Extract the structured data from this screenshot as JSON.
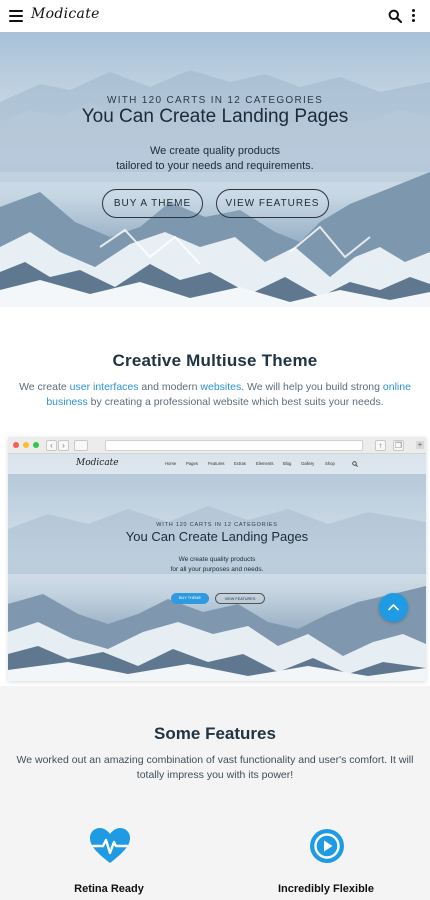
{
  "topbar": {
    "logo": "Modicate",
    "menu_icon": "hamburger-menu-icon",
    "search_icon": "search-icon",
    "more_icon": "more-vertical-icon"
  },
  "hero": {
    "eyebrow": "WITH 120 CARTS IN 12 CATEGORIES",
    "title": "You Can Create Landing Pages",
    "subtitle_line1": "We create quality products",
    "subtitle_line2": "tailored to your needs and requirements.",
    "buy_label": "BUY A THEME",
    "view_label": "VIEW FEATURES"
  },
  "intro": {
    "title": "Creative Multiuse Theme",
    "text_1": "We create ",
    "link_1": "user interfaces",
    "text_2": " and modern ",
    "link_2": "websites",
    "text_3": ". We will help you build strong ",
    "link_3": "online business",
    "text_4": " by creating a professional website which best suits your needs."
  },
  "mockup": {
    "logo": "Modicate",
    "menu": [
      "Home",
      "Pages",
      "Features",
      "Extras",
      "Elements",
      "Blog",
      "Gallery",
      "Shop"
    ],
    "eyebrow": "WITH 120 CARTS IN 12 CATEGORIES",
    "title": "You Can Create Landing Pages",
    "subtitle_line1": "We create quality products",
    "subtitle_line2": "for all your purposes and needs.",
    "buy_label": "BUY THEME",
    "view_label": "VIEW FEATURES"
  },
  "scroll_top_icon": "chevron-up-icon",
  "features": {
    "title": "Some Features",
    "text": "We worked out an amazing combination of vast functionality and user's comfort. It will totally impress you with its power!",
    "items": [
      {
        "label": "Retina Ready",
        "icon": "heartbeat-icon"
      },
      {
        "label": "Incredibly Flexible",
        "icon": "flexible-play-icon"
      }
    ]
  },
  "colors": {
    "accent": "#1f9be3",
    "heading": "#213444",
    "link": "#2a92d6"
  }
}
